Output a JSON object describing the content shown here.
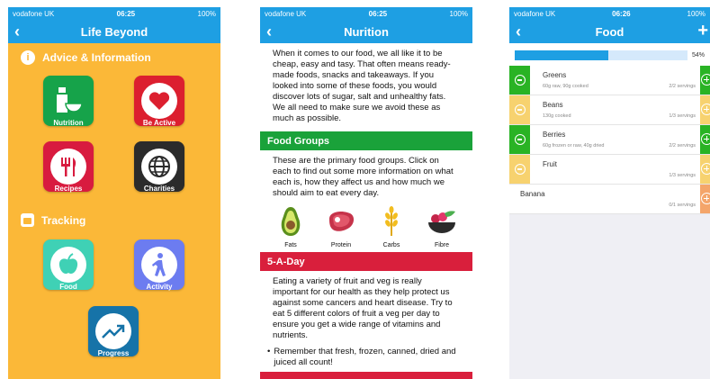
{
  "status_bars": [
    {
      "carrier": "vodafone UK",
      "time": "06:25",
      "battery": "100%"
    },
    {
      "carrier": "vodafone UK",
      "time": "06:25",
      "battery": "100%"
    },
    {
      "carrier": "vodafone UK",
      "time": "06:26",
      "battery": "100%"
    }
  ],
  "screen1": {
    "title": "Life Beyond",
    "advice_heading": "Advice & Information",
    "tracking_heading": "Tracking",
    "tiles": {
      "nutrition": "Nutrition",
      "be_active": "Be Active",
      "recipes": "Recipes",
      "charities": "Charities",
      "food": "Food",
      "activity": "Activity",
      "progress": "Progress"
    },
    "colors": {
      "background": "#fbb838",
      "nutrition": "#16a34a",
      "be_active": "#dc1f2f",
      "recipes": "#d81b3f",
      "charities": "#2b2b2b",
      "food": "#3fd1b5",
      "activity": "#6c7cf0",
      "progress": "#1673a8"
    }
  },
  "screen2": {
    "title": "Nurition",
    "intro": "When it comes to our food, we all like it to be cheap, easy and tasy. That often means ready-made foods, snacks and takeaways. If you looked into some of these foods, you would discover lots of sugar, salt and unhealthy fats. We all need to make sure we avoid these as much as possible.",
    "food_groups_heading": "Food Groups",
    "food_groups_text": "These are the primary food groups. Click on each to find out some more information on what each is, how they affect us and how much we should aim to eat every day.",
    "food_groups": [
      "Fats",
      "Protein",
      "Carbs",
      "Fibre"
    ],
    "five_a_day_heading": "5-A-Day",
    "five_a_day_text": "Eating a variety of fruit and veg is really important for our health as they help protect us against some cancers and heart disease. Try to eat 5 different colors of fruit a veg per day to ensure you get a wide range of vitamins and nutrients.",
    "bullet": "Remember that fresh, frozen, canned, dried and juiced all count!",
    "colors": {
      "food_groups": "#1aa23a",
      "five_a_day": "#d91f3c"
    }
  },
  "screen3": {
    "title": "Food",
    "progress_percent": 54,
    "progress_label": "54%",
    "items": [
      {
        "name": "Greens",
        "detail": "60g raw, 90g cooked",
        "servings": "2/2 servings",
        "done": true
      },
      {
        "name": "Beans",
        "detail": "130g cooked",
        "servings": "1/3 servings",
        "done": false
      },
      {
        "name": "Berries",
        "detail": "60g frozen or raw, 40g dried",
        "servings": "2/2 servings",
        "done": true
      },
      {
        "name": "Fruit",
        "detail": "",
        "servings": "1/3 servings",
        "done": false
      }
    ],
    "sub_item": {
      "name": "Banana",
      "servings": "0/1 servings"
    },
    "colors": {
      "done": "#29b324",
      "partial": "#f7d26f",
      "sub_add": "#f4a56a",
      "accent": "#1e9fe3"
    }
  }
}
